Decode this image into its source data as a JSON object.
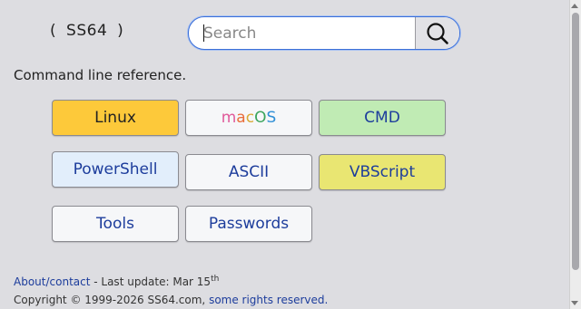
{
  "logo": {
    "open_paren": "(",
    "text": "SS64",
    "close_paren": ")"
  },
  "search": {
    "placeholder": "Search",
    "value": "",
    "button_icon": "search-icon"
  },
  "tagline": "Command line reference.",
  "buttons": {
    "linux": "Linux",
    "macos": "macOS",
    "cmd": "CMD",
    "powershell": "PowerShell",
    "ascii": "ASCII",
    "vbscript": "VBScript",
    "tools": "Tools",
    "passwords": "Passwords"
  },
  "macos_colors": [
    "#e05a9a",
    "#e96d3a",
    "#d9a935",
    "#3ba55c",
    "#2f8fd6"
  ],
  "footer": {
    "about_link": "About/contact",
    "last_update_text": " - Last update: Mar 15",
    "last_update_sup": "th",
    "copyright_text": "Copyright © 1999-2026 SS64.com, ",
    "rights_link": "some rights reserved."
  },
  "colors": {
    "link": "#1d3d9c",
    "linux_bg": "#fdc93a",
    "cmd_bg": "#c0ebb4",
    "powershell_bg": "#e2eefb",
    "vbscript_bg": "#e9e672",
    "page_bg": "#dddde1"
  }
}
